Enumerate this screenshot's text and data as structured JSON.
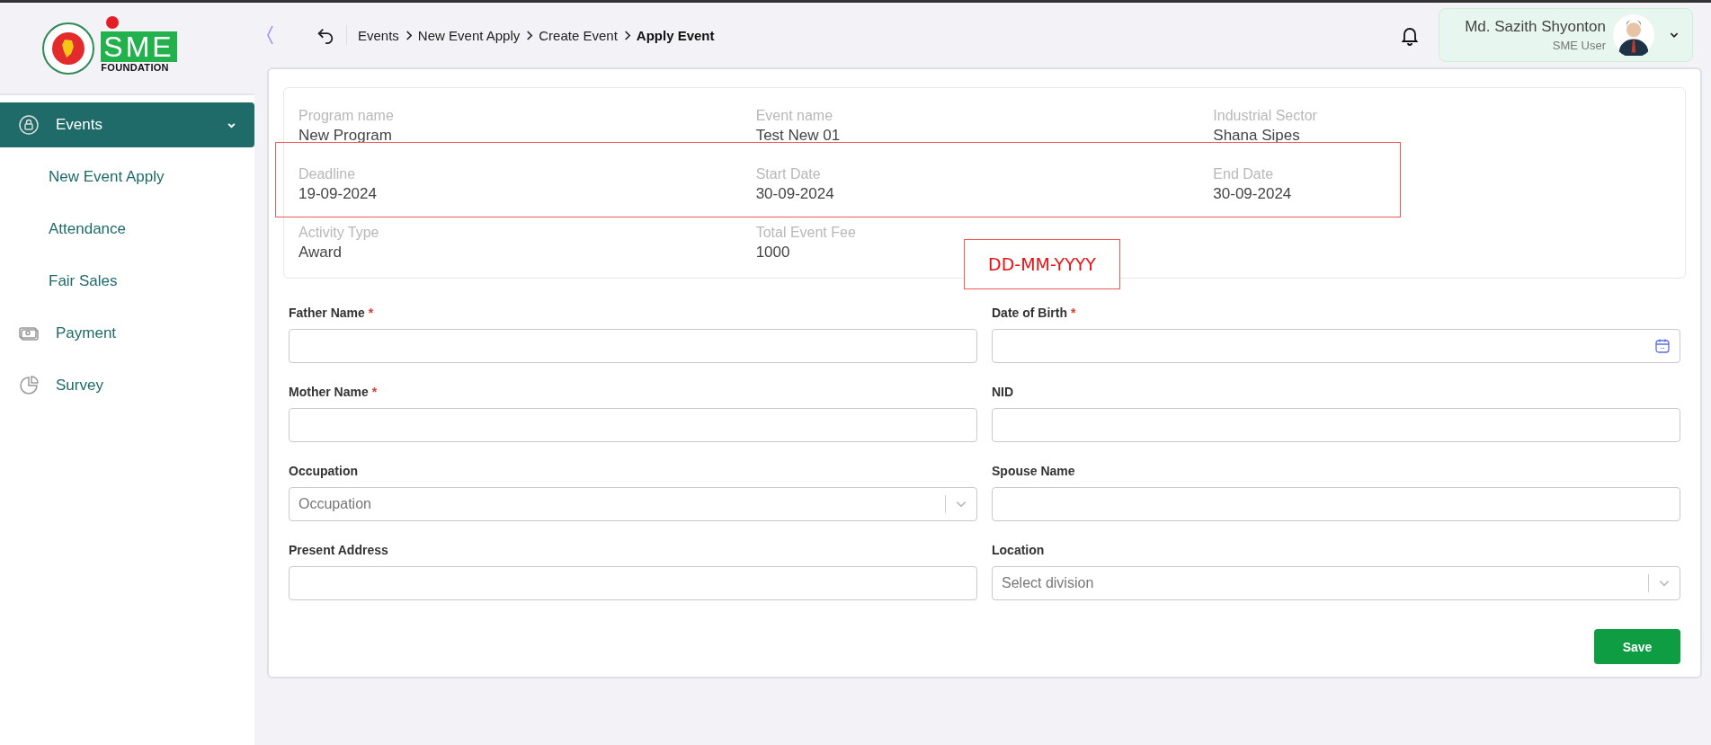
{
  "logo": {
    "wordmark": "SME",
    "subtitle": "FOUNDATION"
  },
  "sidebar": {
    "items": [
      {
        "label": "Events",
        "selected": true,
        "expanded": true,
        "children": [
          {
            "label": "New Event Apply"
          },
          {
            "label": "Attendance"
          },
          {
            "label": "Fair Sales"
          }
        ]
      },
      {
        "label": "Payment",
        "selected": false
      },
      {
        "label": "Survey",
        "selected": false
      }
    ]
  },
  "breadcrumbs": [
    {
      "label": "Events",
      "current": false
    },
    {
      "label": "New Event Apply",
      "current": false
    },
    {
      "label": "Create Event",
      "current": false
    },
    {
      "label": "Apply Event",
      "current": true
    }
  ],
  "user": {
    "name": "Md. Sazith Shyonton",
    "role": "SME User"
  },
  "summary": [
    {
      "label": "Program name",
      "value": "New Program"
    },
    {
      "label": "Event name",
      "value": "Test New 01"
    },
    {
      "label": "Industrial Sector",
      "value": "Shana Sipes"
    },
    {
      "label": "Deadline",
      "value": "19-09-2024"
    },
    {
      "label": "Start Date",
      "value": "30-09-2024"
    },
    {
      "label": "End Date",
      "value": "30-09-2024"
    },
    {
      "label": "Activity Type",
      "value": "Award"
    },
    {
      "label": "Total Event Fee",
      "value": "1000"
    }
  ],
  "annotation": {
    "text": "DD-MM-YYYY"
  },
  "form": {
    "fields": [
      {
        "label": "Father Name",
        "required_mark": "*",
        "kind": "text"
      },
      {
        "label": "Date of Birth",
        "required_mark": "*",
        "kind": "date"
      },
      {
        "label": "Mother Name",
        "required_mark": "*",
        "kind": "text"
      },
      {
        "label": "NID",
        "kind": "text"
      },
      {
        "label": "Occupation",
        "kind": "select",
        "placeholder": "Occupation"
      },
      {
        "label": "Spouse Name",
        "kind": "text"
      },
      {
        "label": "Present Address",
        "kind": "text"
      },
      {
        "label": "Location",
        "kind": "select",
        "placeholder": "Select division"
      }
    ],
    "submit": "Save"
  }
}
